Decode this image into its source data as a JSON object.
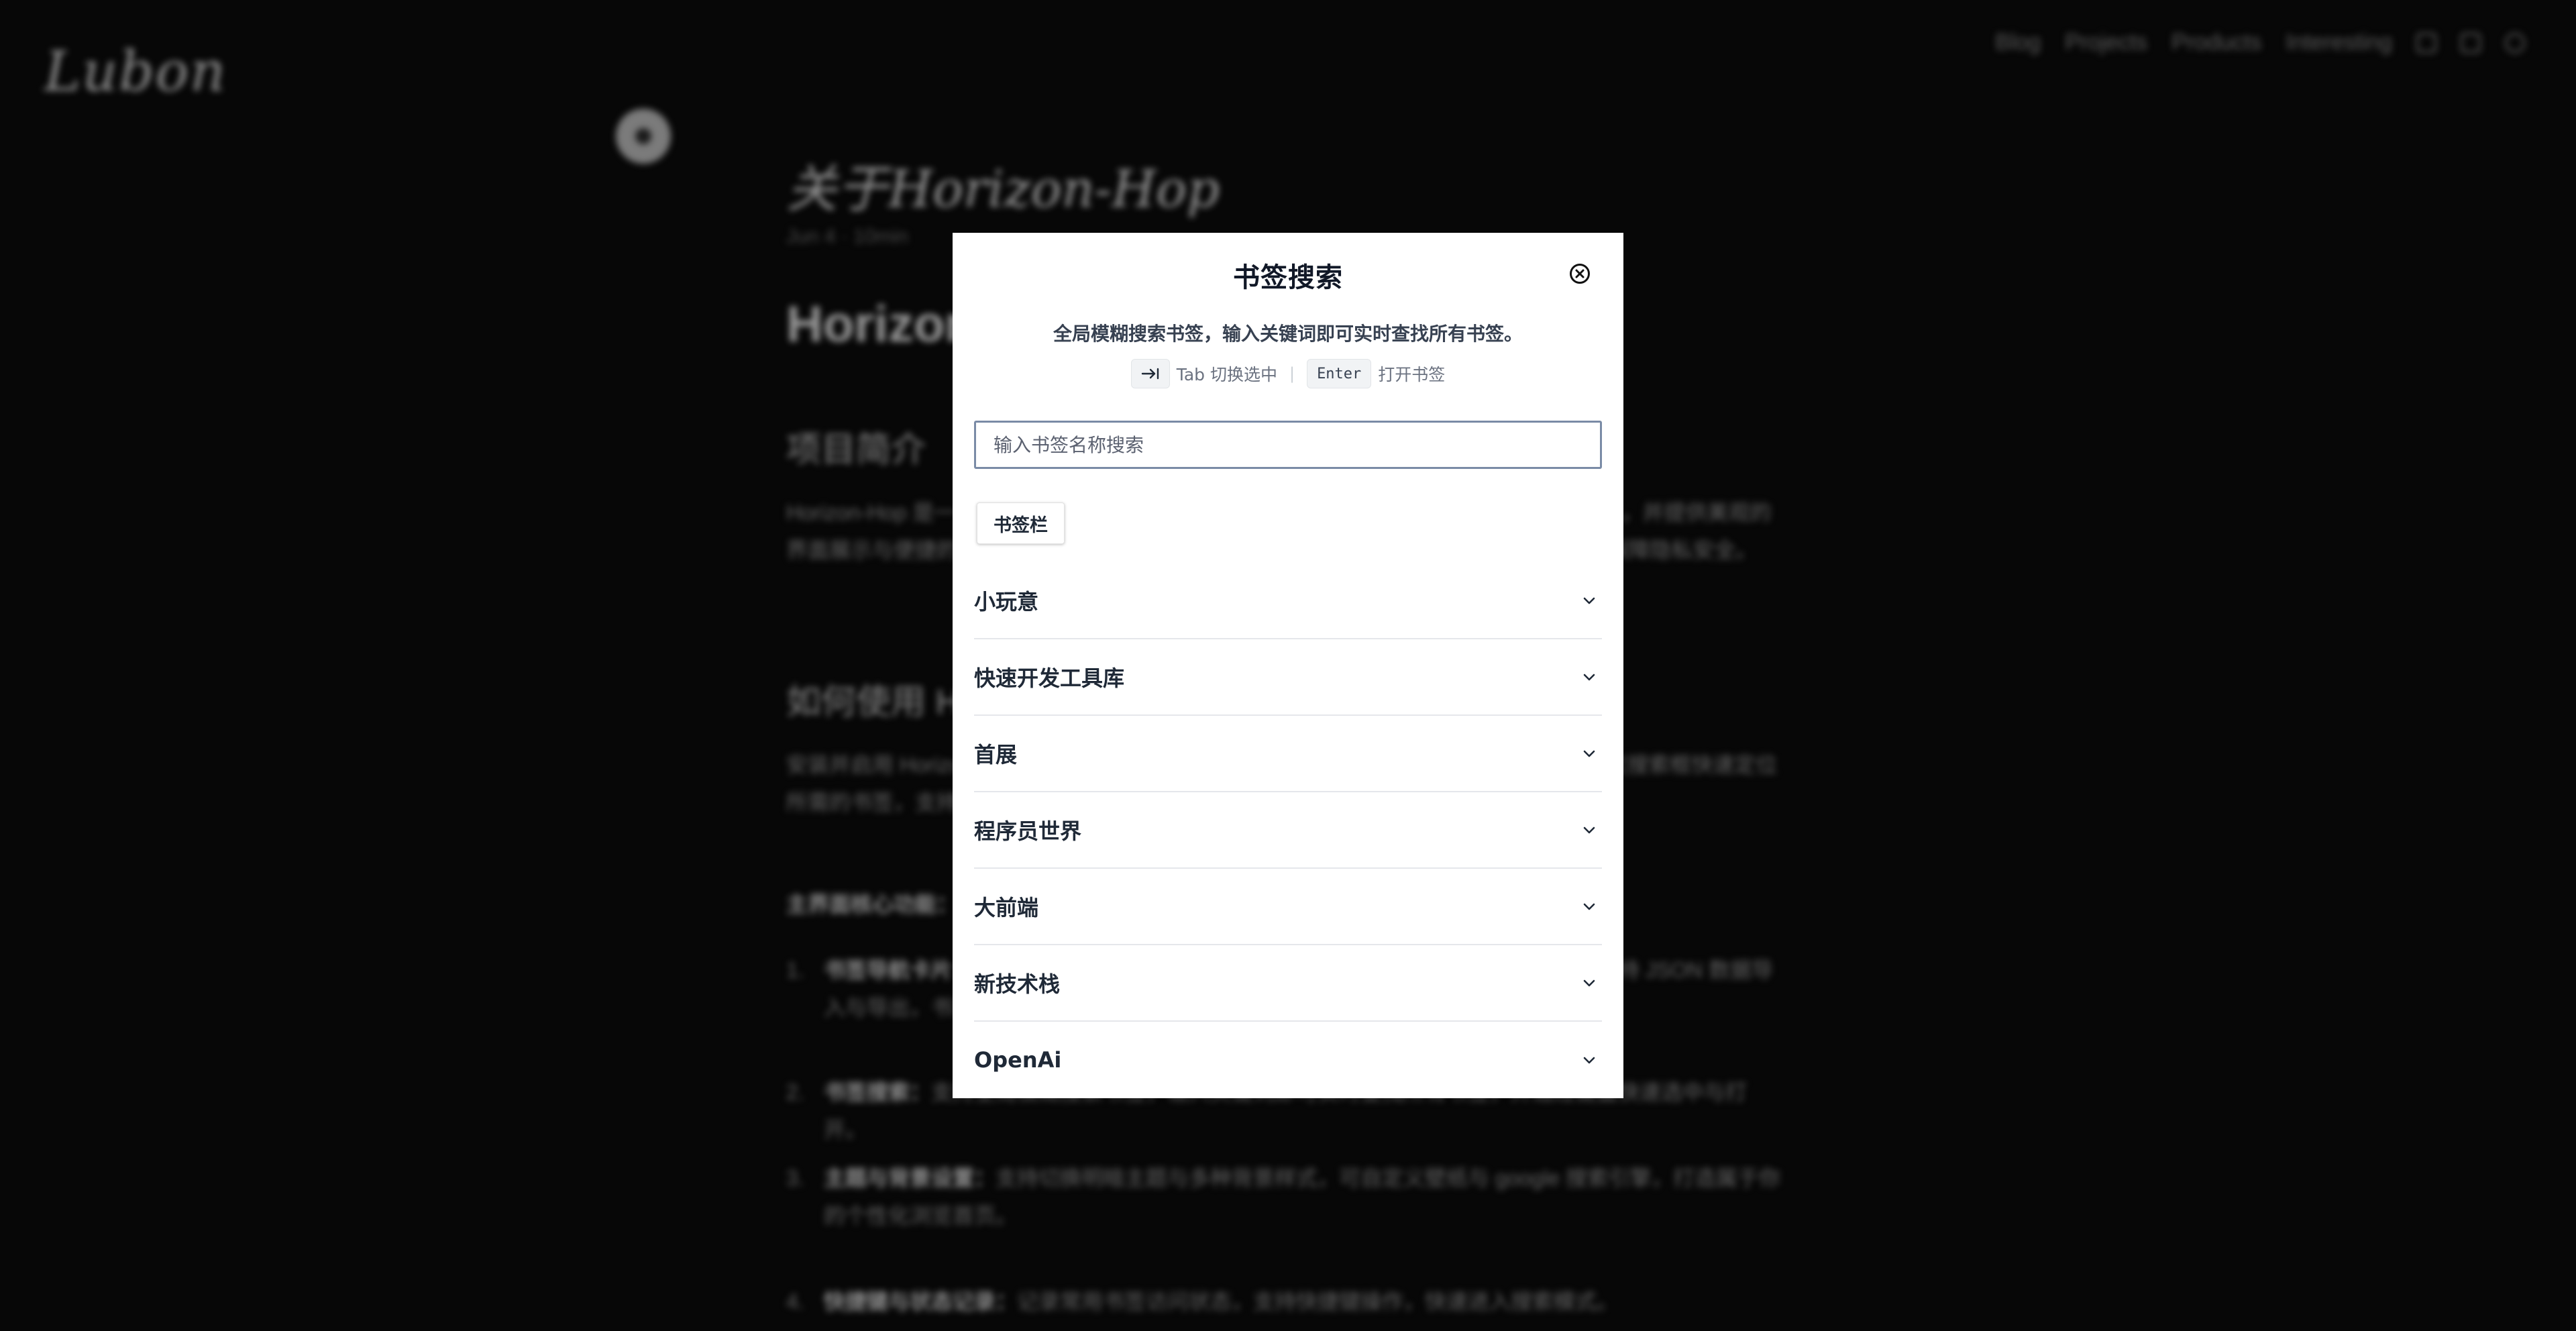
{
  "background": {
    "logo": "Lubon",
    "nav": [
      "Blog",
      "Projects",
      "Products",
      "Interesting"
    ],
    "post_title": "关于Horizon-Hop",
    "post_meta": "Jun 4 · 10min",
    "heading": "Horizon-Hop",
    "section_intro": "项目简介",
    "intro_text": "Horizon-Hop 是一个基于浏览器书签的快捷导航扩展，帮助你快速查找、打开收藏的网站，并提供美观的界面展示与便捷的键盘操作体验，支持书签数据导入导出与 JSON 格式转换，本地存储保障隐私安全。",
    "section_usage": "如何使用 Horizon-Hop",
    "usage_text": "安装并启用 Horizon-Hop 扩展后，点击浏览器工具栏中的图标即可打开书签导航页，通过搜索框快速定位所需的书签，支持分类浏览与键盘快捷操作，让你的浏览更加高效。",
    "features_title": "主界面核心功能：",
    "features": [
      {
        "num": "1.",
        "bold": "书签导航卡片：",
        "text": "将浏览器书签按文件夹分类展示为卡片，点击即可打开对应网站，支持 JSON 数据导入与导出，书签栏分类一目了然，便于管理与快速访问常用网站。"
      },
      {
        "num": "2.",
        "bold": "书签搜索：",
        "text": "支持全局模糊搜索书签，输入关键词即可实时查找所有书签，并通过键盘快速选中与打开。"
      },
      {
        "num": "3.",
        "bold": "主题与背景设置：",
        "text": "支持切换明暗主题与多种背景样式，可自定义壁纸与 google 搜索引擎，打造属于你的个性化浏览首页。"
      },
      {
        "num": "4.",
        "bold": "快捷键与状态记录：",
        "text": "记录常用书签访问状态，支持快捷键操作，快速进入搜索模式。"
      }
    ]
  },
  "modal": {
    "title": "书签搜索",
    "description": "全局模糊搜索书签，输入关键词即可实时查找所有书签。",
    "tab_hint": "Tab 切换选中",
    "enter_key": "Enter",
    "enter_hint": "打开书签",
    "search_placeholder": "输入书签名称搜索",
    "folder_chip": "书签栏",
    "categories": [
      {
        "label": "小玩意"
      },
      {
        "label": "快速开发工具库"
      },
      {
        "label": "首展"
      },
      {
        "label": "程序员世界"
      },
      {
        "label": "大前端"
      },
      {
        "label": "新技术栈"
      },
      {
        "label": "OpenAi"
      }
    ]
  },
  "colors": {
    "modal_bg": "#ffffff",
    "input_border": "#7a8ba6",
    "overlay": "#000000"
  }
}
